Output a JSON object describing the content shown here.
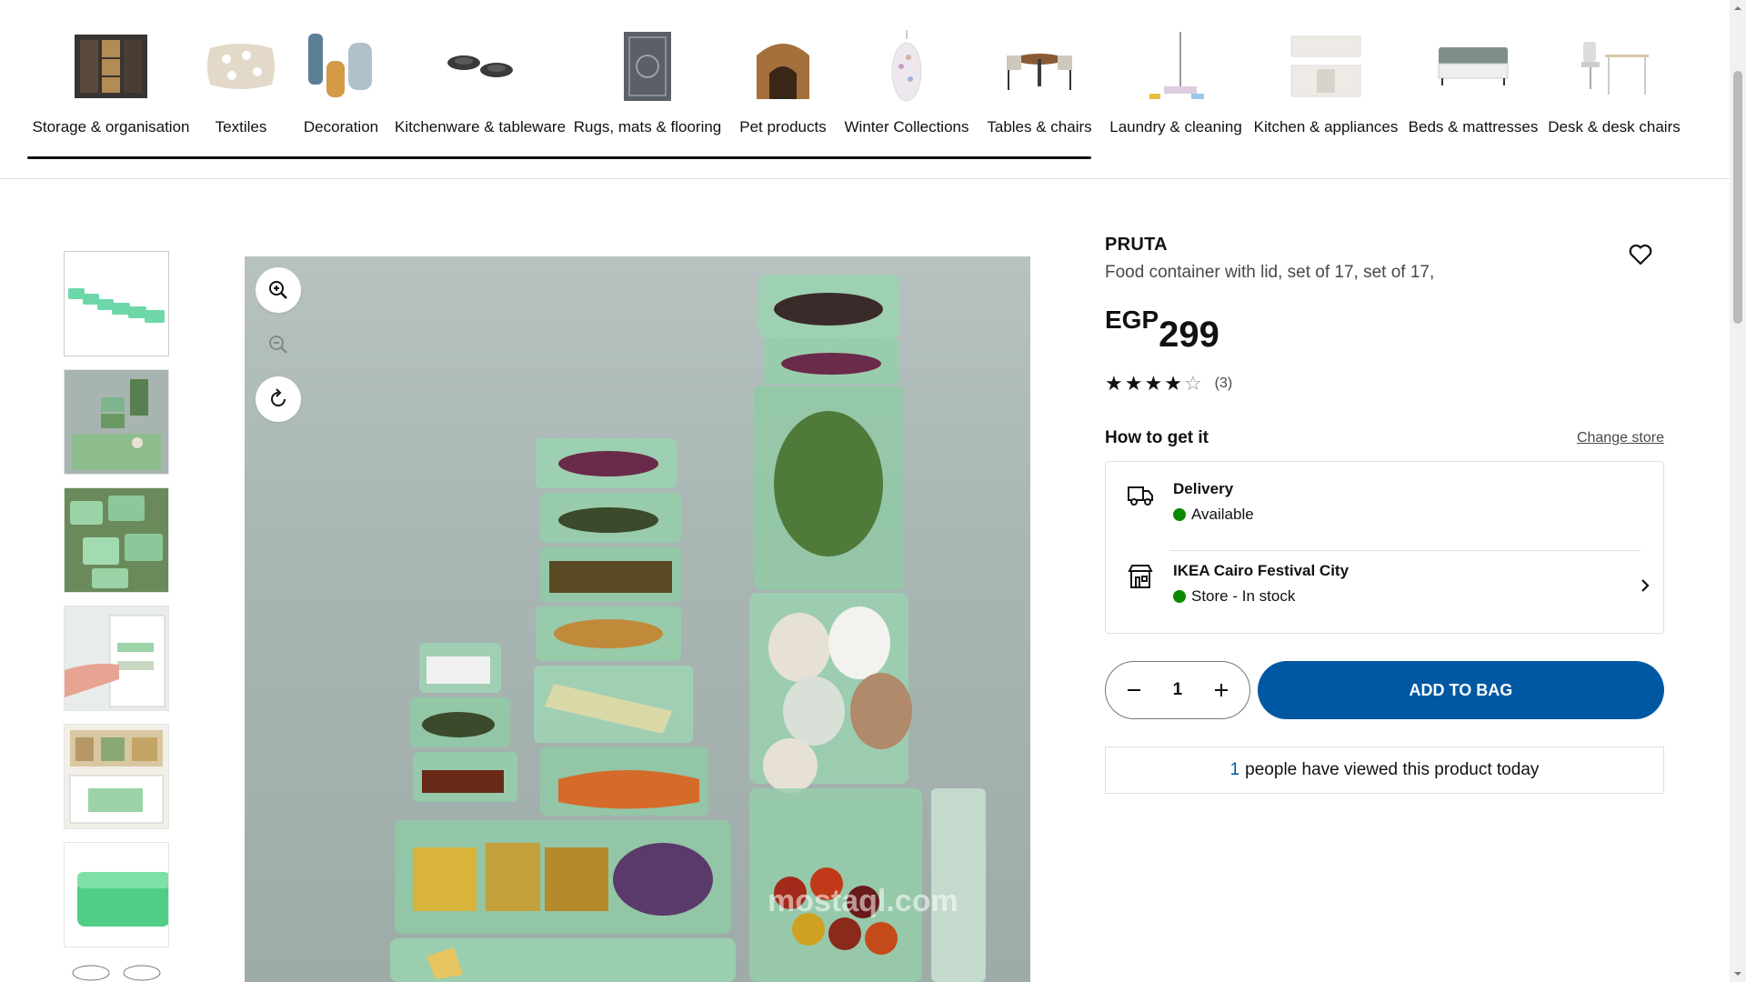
{
  "categories": [
    {
      "label": "Storage & organisation",
      "icon": "shelving-unit"
    },
    {
      "label": "Textiles",
      "icon": "cushion"
    },
    {
      "label": "Decoration",
      "icon": "vases"
    },
    {
      "label": "Kitchenware & tableware",
      "icon": "plates"
    },
    {
      "label": "Rugs, mats & flooring",
      "icon": "rug"
    },
    {
      "label": "Pet products",
      "icon": "pet-house"
    },
    {
      "label": "Winter Collections",
      "icon": "lamp"
    },
    {
      "label": "Tables & chairs",
      "icon": "dining-set"
    },
    {
      "label": "Laundry & cleaning",
      "icon": "mop"
    },
    {
      "label": "Kitchen & appliances",
      "icon": "kitchen"
    },
    {
      "label": "Beds & mattresses",
      "icon": "bed"
    },
    {
      "label": "Desk & desk chairs",
      "icon": "desk"
    }
  ],
  "image_watermark": "mostaql.com",
  "product": {
    "brand": "PRUTA",
    "description": "Food container with lid, set of 17, set of 17,",
    "currency": "EGP",
    "price": "299",
    "rating": 4,
    "rating_max": 5,
    "review_count": "(3)"
  },
  "availability": {
    "title": "How to get it",
    "change_store": "Change store",
    "delivery_title": "Delivery",
    "delivery_status": "Available",
    "store_title": "IKEA Cairo Festival City",
    "store_status": "Store - In stock",
    "status_color": "#0a8a00"
  },
  "purchase": {
    "quantity": "1",
    "add_to_bag": "ADD TO BAG",
    "button_color": "#0058a3"
  },
  "views": {
    "count": "1",
    "text": "people have viewed this product today"
  }
}
